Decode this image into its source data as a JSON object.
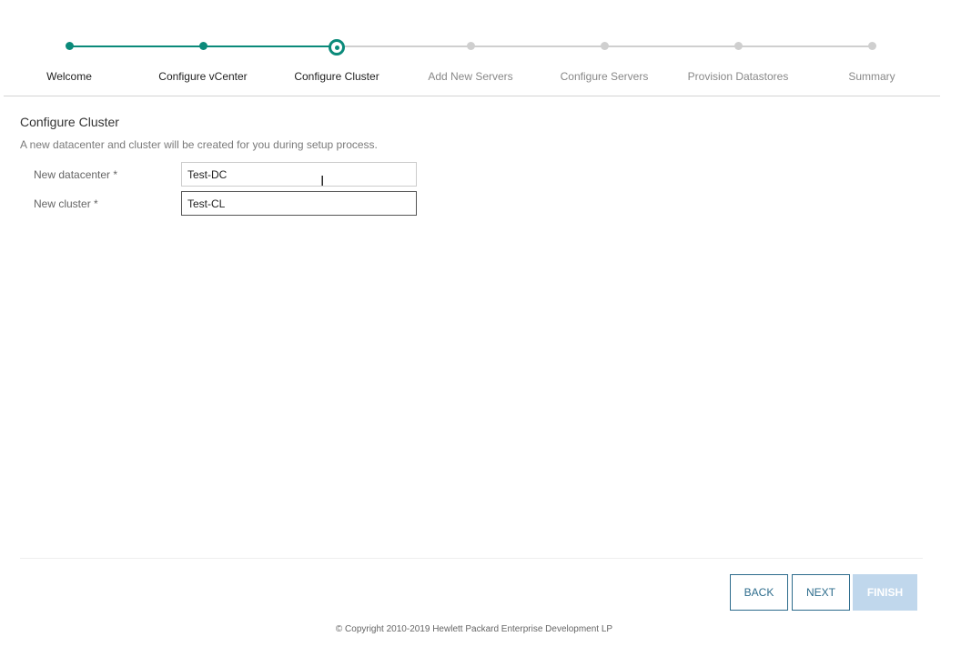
{
  "stepper": {
    "steps": [
      {
        "label": "Welcome",
        "state": "done"
      },
      {
        "label": "Configure vCenter",
        "state": "done"
      },
      {
        "label": "Configure Cluster",
        "state": "current"
      },
      {
        "label": "Add New Servers",
        "state": "todo"
      },
      {
        "label": "Configure Servers",
        "state": "todo"
      },
      {
        "label": "Provision Datastores",
        "state": "todo"
      },
      {
        "label": "Summary",
        "state": "todo"
      }
    ],
    "current_step": 3,
    "total_steps": 7
  },
  "form": {
    "title": "Configure Cluster",
    "description": "A new datacenter and cluster will be created for you during setup process.",
    "datacenter_label": "New datacenter *",
    "datacenter_value": "Test-DC",
    "cluster_label": "New cluster *",
    "cluster_value": "Test-CL"
  },
  "cursor": {
    "icon": "text-cursor-icon",
    "glyph": "I"
  },
  "actions": {
    "back_label": "BACK",
    "next_label": "NEXT",
    "finish_label": "FINISH",
    "finish_enabled": false
  },
  "footer": {
    "copyright": "© Copyright 2010-2019 Hewlett Packard Enterprise Development LP"
  },
  "colors": {
    "accent": "#0b8a7a",
    "inactive_step": "#cfcfcf",
    "button_border": "#2d6c8c",
    "finish_disabled": "#c0d7ec"
  }
}
